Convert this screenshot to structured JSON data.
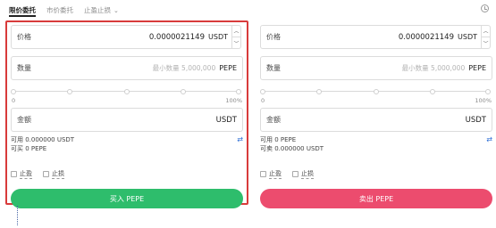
{
  "tabs": [
    {
      "label": "限价委托",
      "active": true
    },
    {
      "label": "市价委托",
      "active": false
    },
    {
      "label": "止盈止损",
      "active": false
    }
  ],
  "tab_dropdown_icon": "chevron-down-icon",
  "history_icon": "clock-icon",
  "buy": {
    "price_label": "价格",
    "price_value": "0.0000021149",
    "price_unit": "USDT",
    "qty_label": "数量",
    "qty_placeholder": "最小数量 5,000,000",
    "qty_unit": "PEPE",
    "slider_min": "0",
    "slider_max": "100%",
    "amount_label": "金额",
    "amount_unit": "USDT",
    "available": "可用 0.000000 USDT",
    "can_trade": "可买 0 PEPE",
    "take_profit": "止盈",
    "stop_loss": "止损",
    "button": "买入 PEPE"
  },
  "sell": {
    "price_label": "价格",
    "price_value": "0.0000021149",
    "price_unit": "USDT",
    "qty_label": "数量",
    "qty_placeholder": "最小数量 5,000,000",
    "qty_unit": "PEPE",
    "slider_min": "0",
    "slider_max": "100%",
    "amount_label": "金额",
    "amount_unit": "USDT",
    "available": "可用 0 PEPE",
    "can_trade": "可卖 0.000000 USDT",
    "take_profit": "止盈",
    "stop_loss": "止损",
    "button": "卖出 PEPE"
  },
  "colors": {
    "buy": "#2ebd6c",
    "sell": "#ec4c6e",
    "highlight": "#d83b3b"
  }
}
